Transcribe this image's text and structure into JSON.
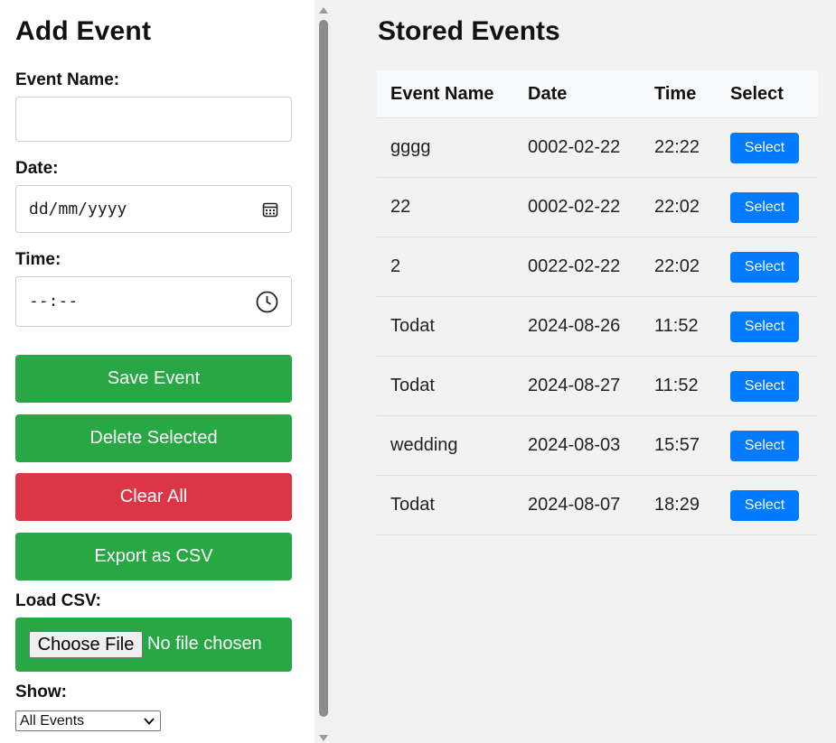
{
  "form": {
    "title": "Add Event",
    "event_name_label": "Event Name:",
    "event_name_value": "",
    "date_label": "Date:",
    "date_placeholder": "dd/mm/yyyy",
    "time_label": "Time:",
    "time_placeholder": "--:--",
    "save_label": "Save Event",
    "delete_label": "Delete Selected",
    "clear_label": "Clear All",
    "export_label": "Export as CSV",
    "load_label": "Load CSV:",
    "choose_file_label": "Choose File",
    "no_file_text": "No file chosen",
    "show_label": "Show:",
    "show_selected": "All Events"
  },
  "events": {
    "title": "Stored Events",
    "columns": [
      "Event Name",
      "Date",
      "Time",
      "Select"
    ],
    "rows": [
      {
        "name": "gggg",
        "date": "0002-02-22",
        "time": "22:22",
        "action": "Select"
      },
      {
        "name": "22",
        "date": "0002-02-22",
        "time": "22:02",
        "action": "Select"
      },
      {
        "name": "2",
        "date": "0022-02-22",
        "time": "22:02",
        "action": "Select"
      },
      {
        "name": "Todat",
        "date": "2024-08-26",
        "time": "11:52",
        "action": "Select"
      },
      {
        "name": "Todat",
        "date": "2024-08-27",
        "time": "11:52",
        "action": "Select"
      },
      {
        "name": "wedding",
        "date": "2024-08-03",
        "time": "15:57",
        "action": "Select"
      },
      {
        "name": "Todat",
        "date": "2024-08-07",
        "time": "18:29",
        "action": "Select"
      }
    ]
  },
  "colors": {
    "green": "#28a745",
    "red": "#dc3545",
    "blue": "#007bff"
  },
  "icons": [
    "calendar-icon",
    "clock-icon",
    "chevron-down-icon",
    "scroll-up-arrow-icon",
    "scroll-down-arrow-icon"
  ]
}
